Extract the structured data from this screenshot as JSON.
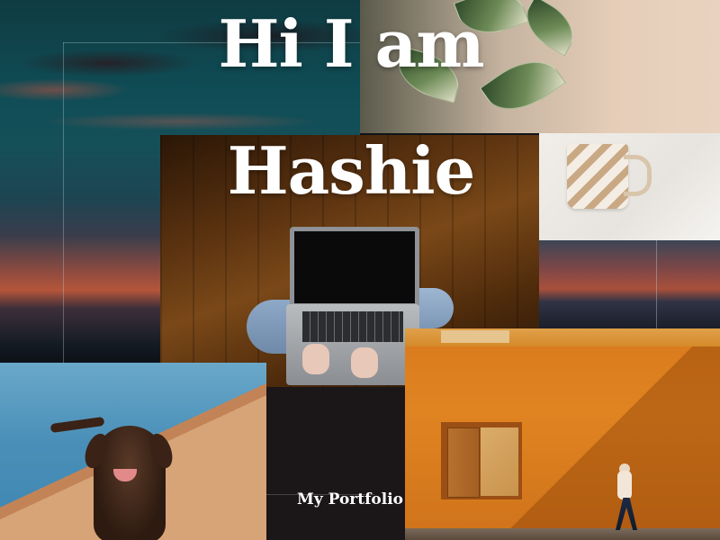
{
  "hero": {
    "line1": "Hi I am",
    "line2": "Hashie"
  },
  "links": {
    "portfolio": "My Portfolio"
  },
  "colors": {
    "hero_text": "#ffffff",
    "dark_panel": "#1b1618",
    "orange_wall": "#d97a1c"
  }
}
